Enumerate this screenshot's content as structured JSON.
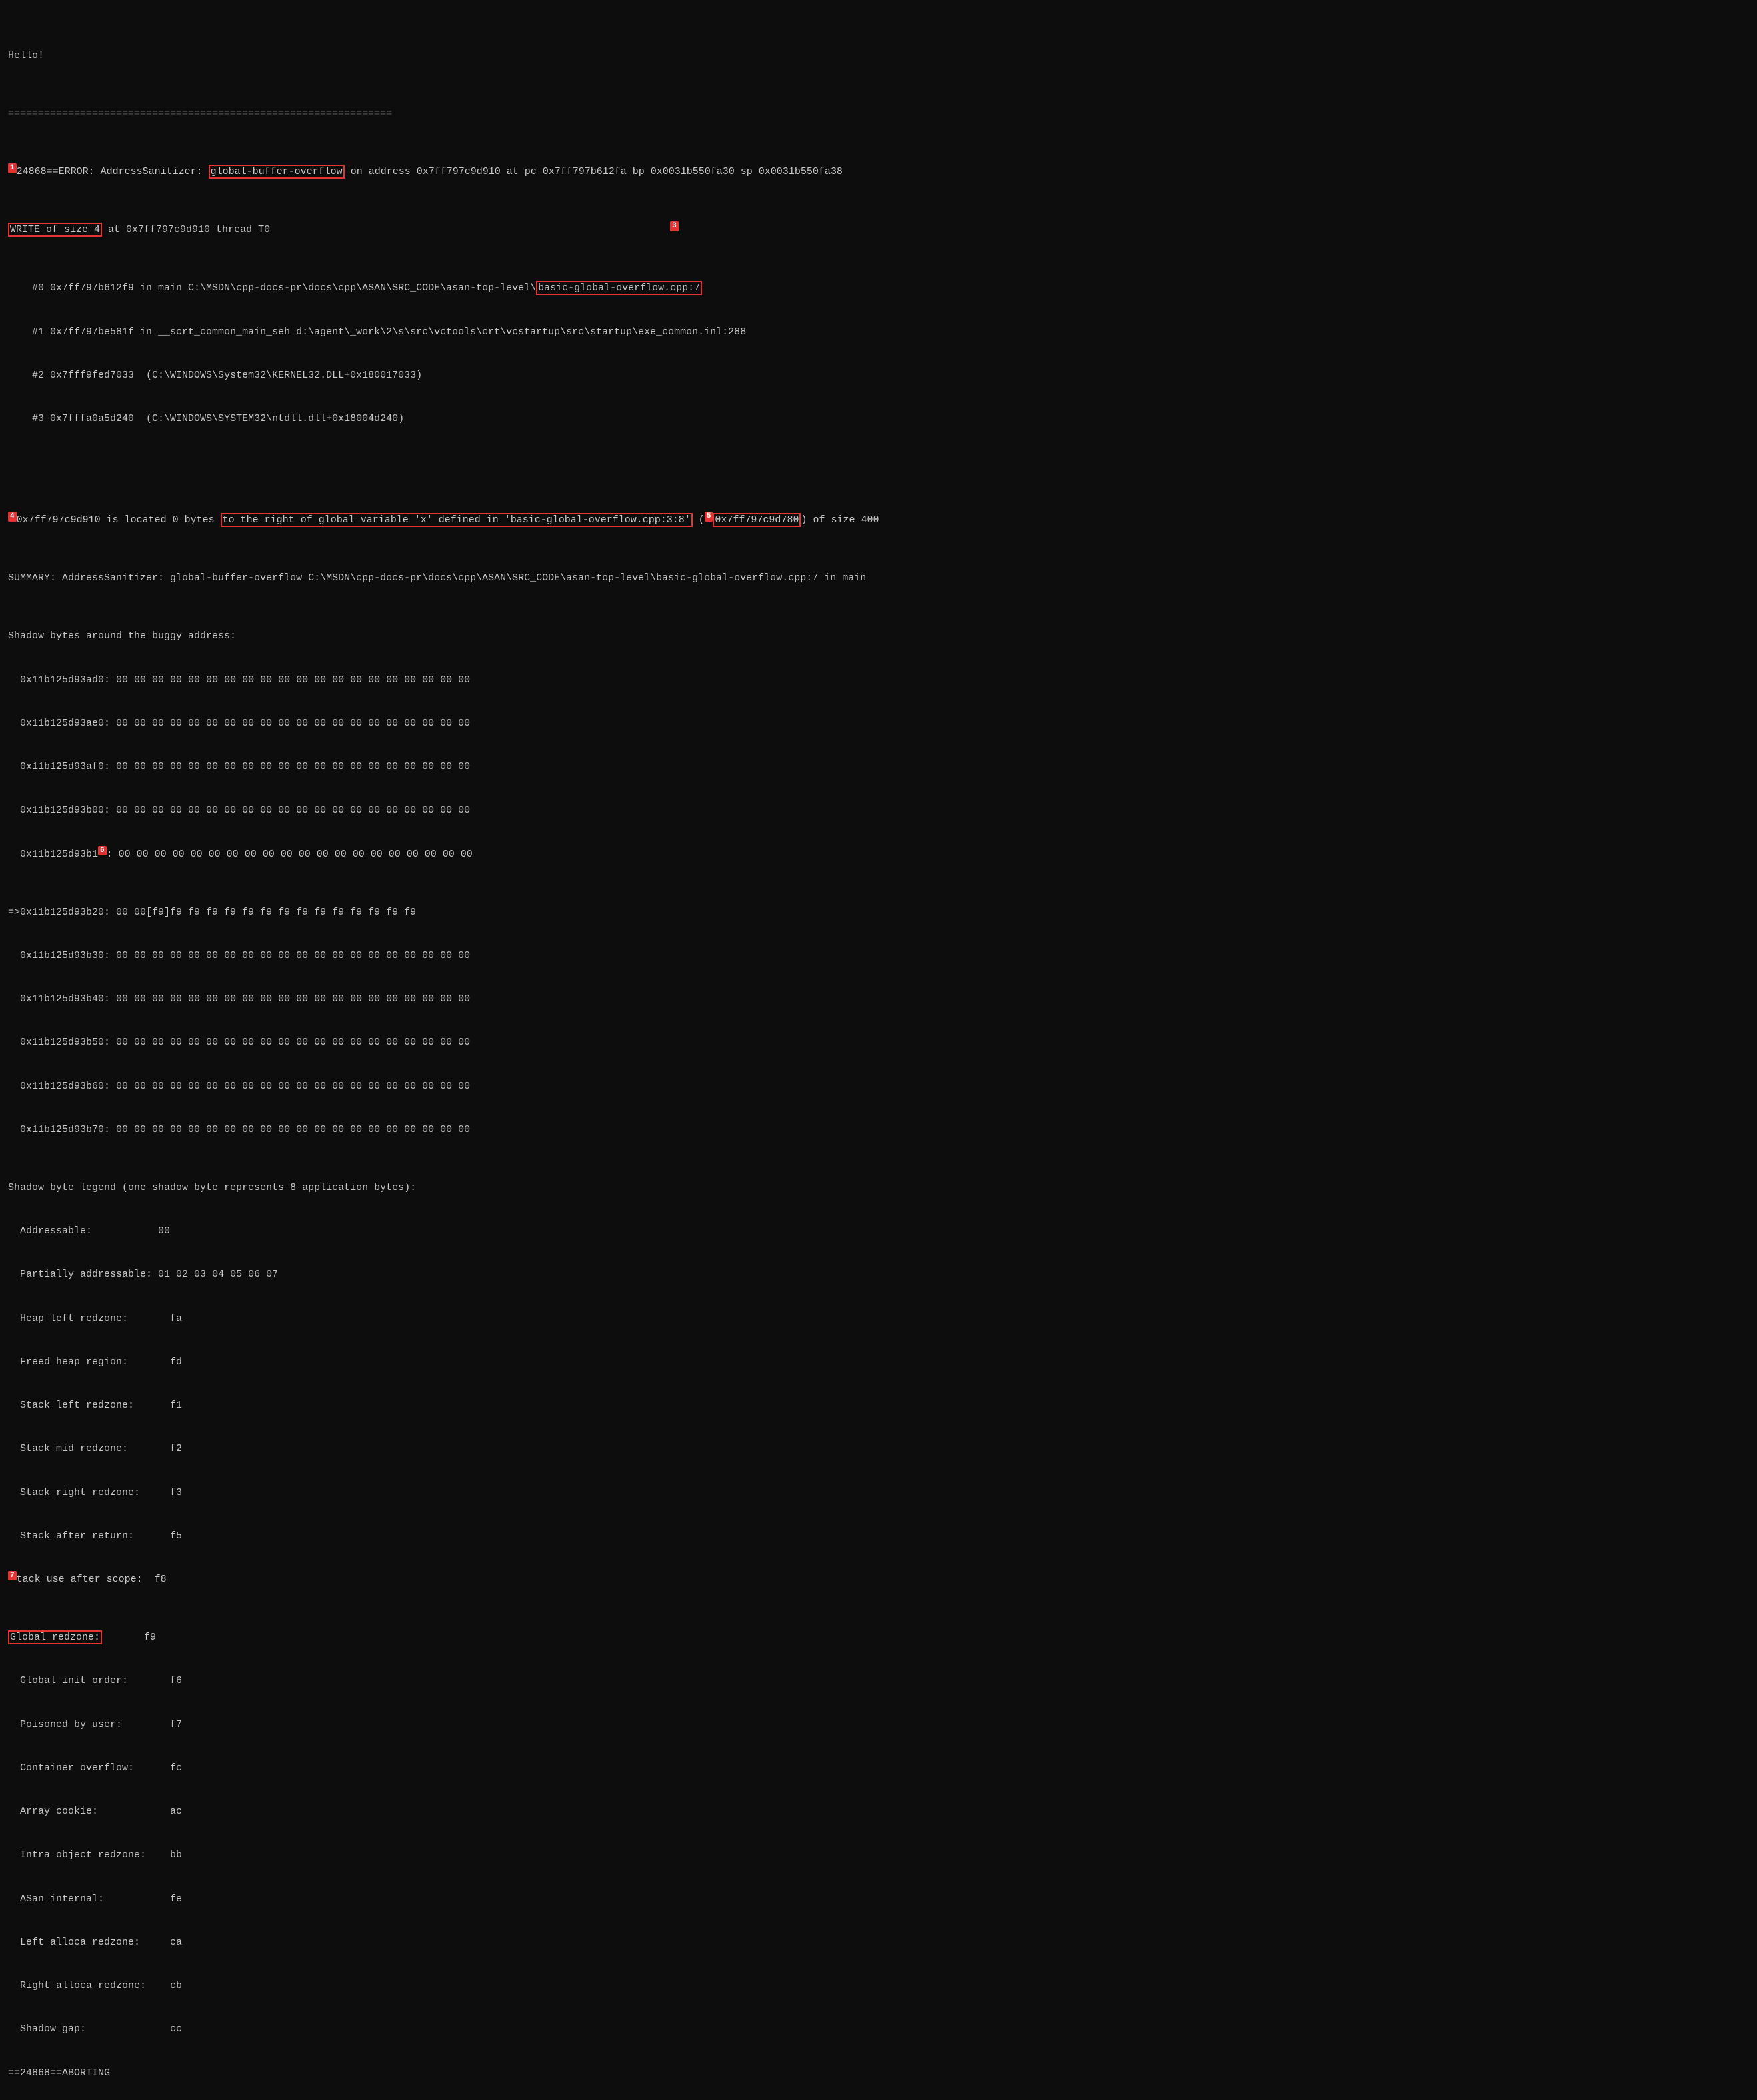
{
  "terminal": {
    "lines": [
      {
        "id": "hello",
        "text": "Hello!",
        "type": "normal"
      },
      {
        "id": "separator1",
        "text": "================================================================",
        "type": "separator"
      },
      {
        "id": "error_main",
        "badge": "1",
        "has_badge": true,
        "type": "error_with_badge",
        "pre_box": "24868==ERROR: AddressSanitizer: ",
        "boxed": "global-buffer-overflow",
        "post_box": " on address 0x7ff797c9d910 at pc 0x7ff797b612fa bp 0x0031b550fa30 sp 0x0031b550fa38"
      },
      {
        "id": "write_line",
        "badge": "write_badge",
        "has_badge": false,
        "type": "write_line",
        "boxed_write": "WRITE of size 4",
        "post_write": " at 0x7ff797c9d910 thread T0"
      },
      {
        "id": "stack0",
        "text": "    #0 0x7ff797b612f9 in main C:\\MSDN\\cpp-docs-pr\\docs\\cpp\\ASAN\\SRC_CODE\\asan-top-level\\",
        "type": "stack",
        "link": "basic-global-overflow.cpp:7"
      },
      {
        "id": "stack1",
        "text": "    #1 0x7ff797be581f in __scrt_common_main_seh d:\\agent\\_work\\2\\s\\src\\vctools\\crt\\vcstartup\\src\\startup\\exe_common.inl:288",
        "type": "normal"
      },
      {
        "id": "stack2",
        "text": "    #2 0x7fff9fed7033  (C:\\WINDOWS\\System32\\KERNEL32.DLL+0x180017033)",
        "type": "normal"
      },
      {
        "id": "stack3",
        "text": "    #3 0x7fffa0a5d240  (C:\\WINDOWS\\SYSTEM32\\ntdll.dll+0x18004d240)",
        "type": "normal"
      },
      {
        "id": "blank1",
        "text": "",
        "type": "normal"
      },
      {
        "id": "located_line",
        "badge4": "4",
        "badge5": "5",
        "type": "located",
        "pre4": "0x7ff797c9d910 is located 0 bytes ",
        "boxed4": "to the right of global variable 'x' defined in 'basic-global-overflow.cpp:3:8'",
        "mid": " (",
        "boxed5": "0x7ff797c9d780",
        "post5": ") of size 400"
      },
      {
        "id": "summary",
        "text": "SUMMARY: AddressSanitizer: global-buffer-overflow C:\\MSDN\\cpp-docs-pr\\docs\\cpp\\ASAN\\SRC_CODE\\asan-top-level\\basic-global-overflow.cpp:7 in main",
        "type": "normal"
      },
      {
        "id": "shadow_header",
        "text": "Shadow bytes around the buggy address:",
        "type": "normal"
      },
      {
        "id": "sh1",
        "text": "  0x11b125d93ad0: 00 00 00 00 00 00 00 00 00 00 00 00 00 00 00 00 00 00 00 00",
        "type": "normal"
      },
      {
        "id": "sh2",
        "text": "  0x11b125d93ae0: 00 00 00 00 00 00 00 00 00 00 00 00 00 00 00 00 00 00 00 00",
        "type": "normal"
      },
      {
        "id": "sh3",
        "text": "  0x11b125d93af0: 00 00 00 00 00 00 00 00 00 00 00 00 00 00 00 00 00 00 00 00",
        "type": "normal"
      },
      {
        "id": "sh4",
        "text": "  0x11b125d93b00: 00 00 00 00 00 00 00 00 00 00 00 00 00 00 00 00 00 00 00 00",
        "type": "normal"
      },
      {
        "id": "sh5",
        "badge": "6",
        "type": "shadow_badge",
        "text": "  0x11b125d93b1"
      },
      {
        "id": "sh6_arrow",
        "text": "=>0x11b125d93b20: 00 00[f9]f9 f9 f9 f9 f9 f9 f9 f9 f9 f9 f9 f9 f9 f9",
        "type": "arrow"
      },
      {
        "id": "sh7",
        "text": "  0x11b125d93b30: 00 00 00 00 00 00 00 00 00 00 00 00 00 00 00 00 00 00 00 00",
        "type": "normal"
      },
      {
        "id": "sh8",
        "text": "  0x11b125d93b40: 00 00 00 00 00 00 00 00 00 00 00 00 00 00 00 00 00 00 00 00",
        "type": "normal"
      },
      {
        "id": "sh9",
        "text": "  0x11b125d93b50: 00 00 00 00 00 00 00 00 00 00 00 00 00 00 00 00 00 00 00 00",
        "type": "normal"
      },
      {
        "id": "sh10",
        "text": "  0x11b125d93b60: 00 00 00 00 00 00 00 00 00 00 00 00 00 00 00 00 00 00 00 00",
        "type": "normal"
      },
      {
        "id": "sh11",
        "text": "  0x11b125d93b70: 00 00 00 00 00 00 00 00 00 00 00 00 00 00 00 00 00 00 00 00",
        "type": "normal"
      },
      {
        "id": "legend_header",
        "text": "Shadow byte legend (one shadow byte represents 8 application bytes):",
        "type": "normal"
      },
      {
        "id": "leg1",
        "text": "  Addressable:           00",
        "type": "normal"
      },
      {
        "id": "leg2",
        "text": "  Partially addressable: 01 02 03 04 05 06 07",
        "type": "normal"
      },
      {
        "id": "leg3",
        "text": "  Heap left redzone:       fa",
        "type": "normal"
      },
      {
        "id": "leg4",
        "text": "  Freed heap region:       fd",
        "type": "normal"
      },
      {
        "id": "leg5",
        "text": "  Stack left redzone:      f1",
        "type": "normal"
      },
      {
        "id": "leg6",
        "text": "  Stack mid redzone:       f2",
        "type": "normal"
      },
      {
        "id": "leg7",
        "text": "  Stack right redzone:     f3",
        "type": "normal"
      },
      {
        "id": "leg8",
        "text": "  Stack after return:      f5",
        "type": "normal"
      },
      {
        "id": "leg9_badge",
        "badge": "7",
        "type": "legend_badge",
        "text_after": "tack use after scope:  f8"
      },
      {
        "id": "leg10_global",
        "type": "global_redzone",
        "boxed": "Global redzone:",
        "value": "       f9"
      },
      {
        "id": "leg11",
        "text": "  Global init order:       f6",
        "type": "normal"
      },
      {
        "id": "leg12",
        "text": "  Poisoned by user:        f7",
        "type": "normal"
      },
      {
        "id": "leg13",
        "text": "  Container overflow:      fc",
        "type": "normal"
      },
      {
        "id": "leg14",
        "text": "  Array cookie:            ac",
        "type": "normal"
      },
      {
        "id": "leg15",
        "text": "  Intra object redzone:    bb",
        "type": "normal"
      },
      {
        "id": "leg16",
        "text": "  ASan internal:           fe",
        "type": "normal"
      },
      {
        "id": "leg17",
        "text": "  Left alloca redzone:     ca",
        "type": "normal"
      },
      {
        "id": "leg18",
        "text": "  Right alloca redzone:    cb",
        "type": "normal"
      },
      {
        "id": "leg19",
        "text": "  Shadow gap:              cc",
        "type": "normal"
      },
      {
        "id": "abort",
        "text": "==24868==ABORTING",
        "type": "normal"
      }
    ],
    "badges": {
      "1": "1",
      "3": "3",
      "4": "4",
      "5": "5",
      "6": "6",
      "7": "7"
    }
  }
}
